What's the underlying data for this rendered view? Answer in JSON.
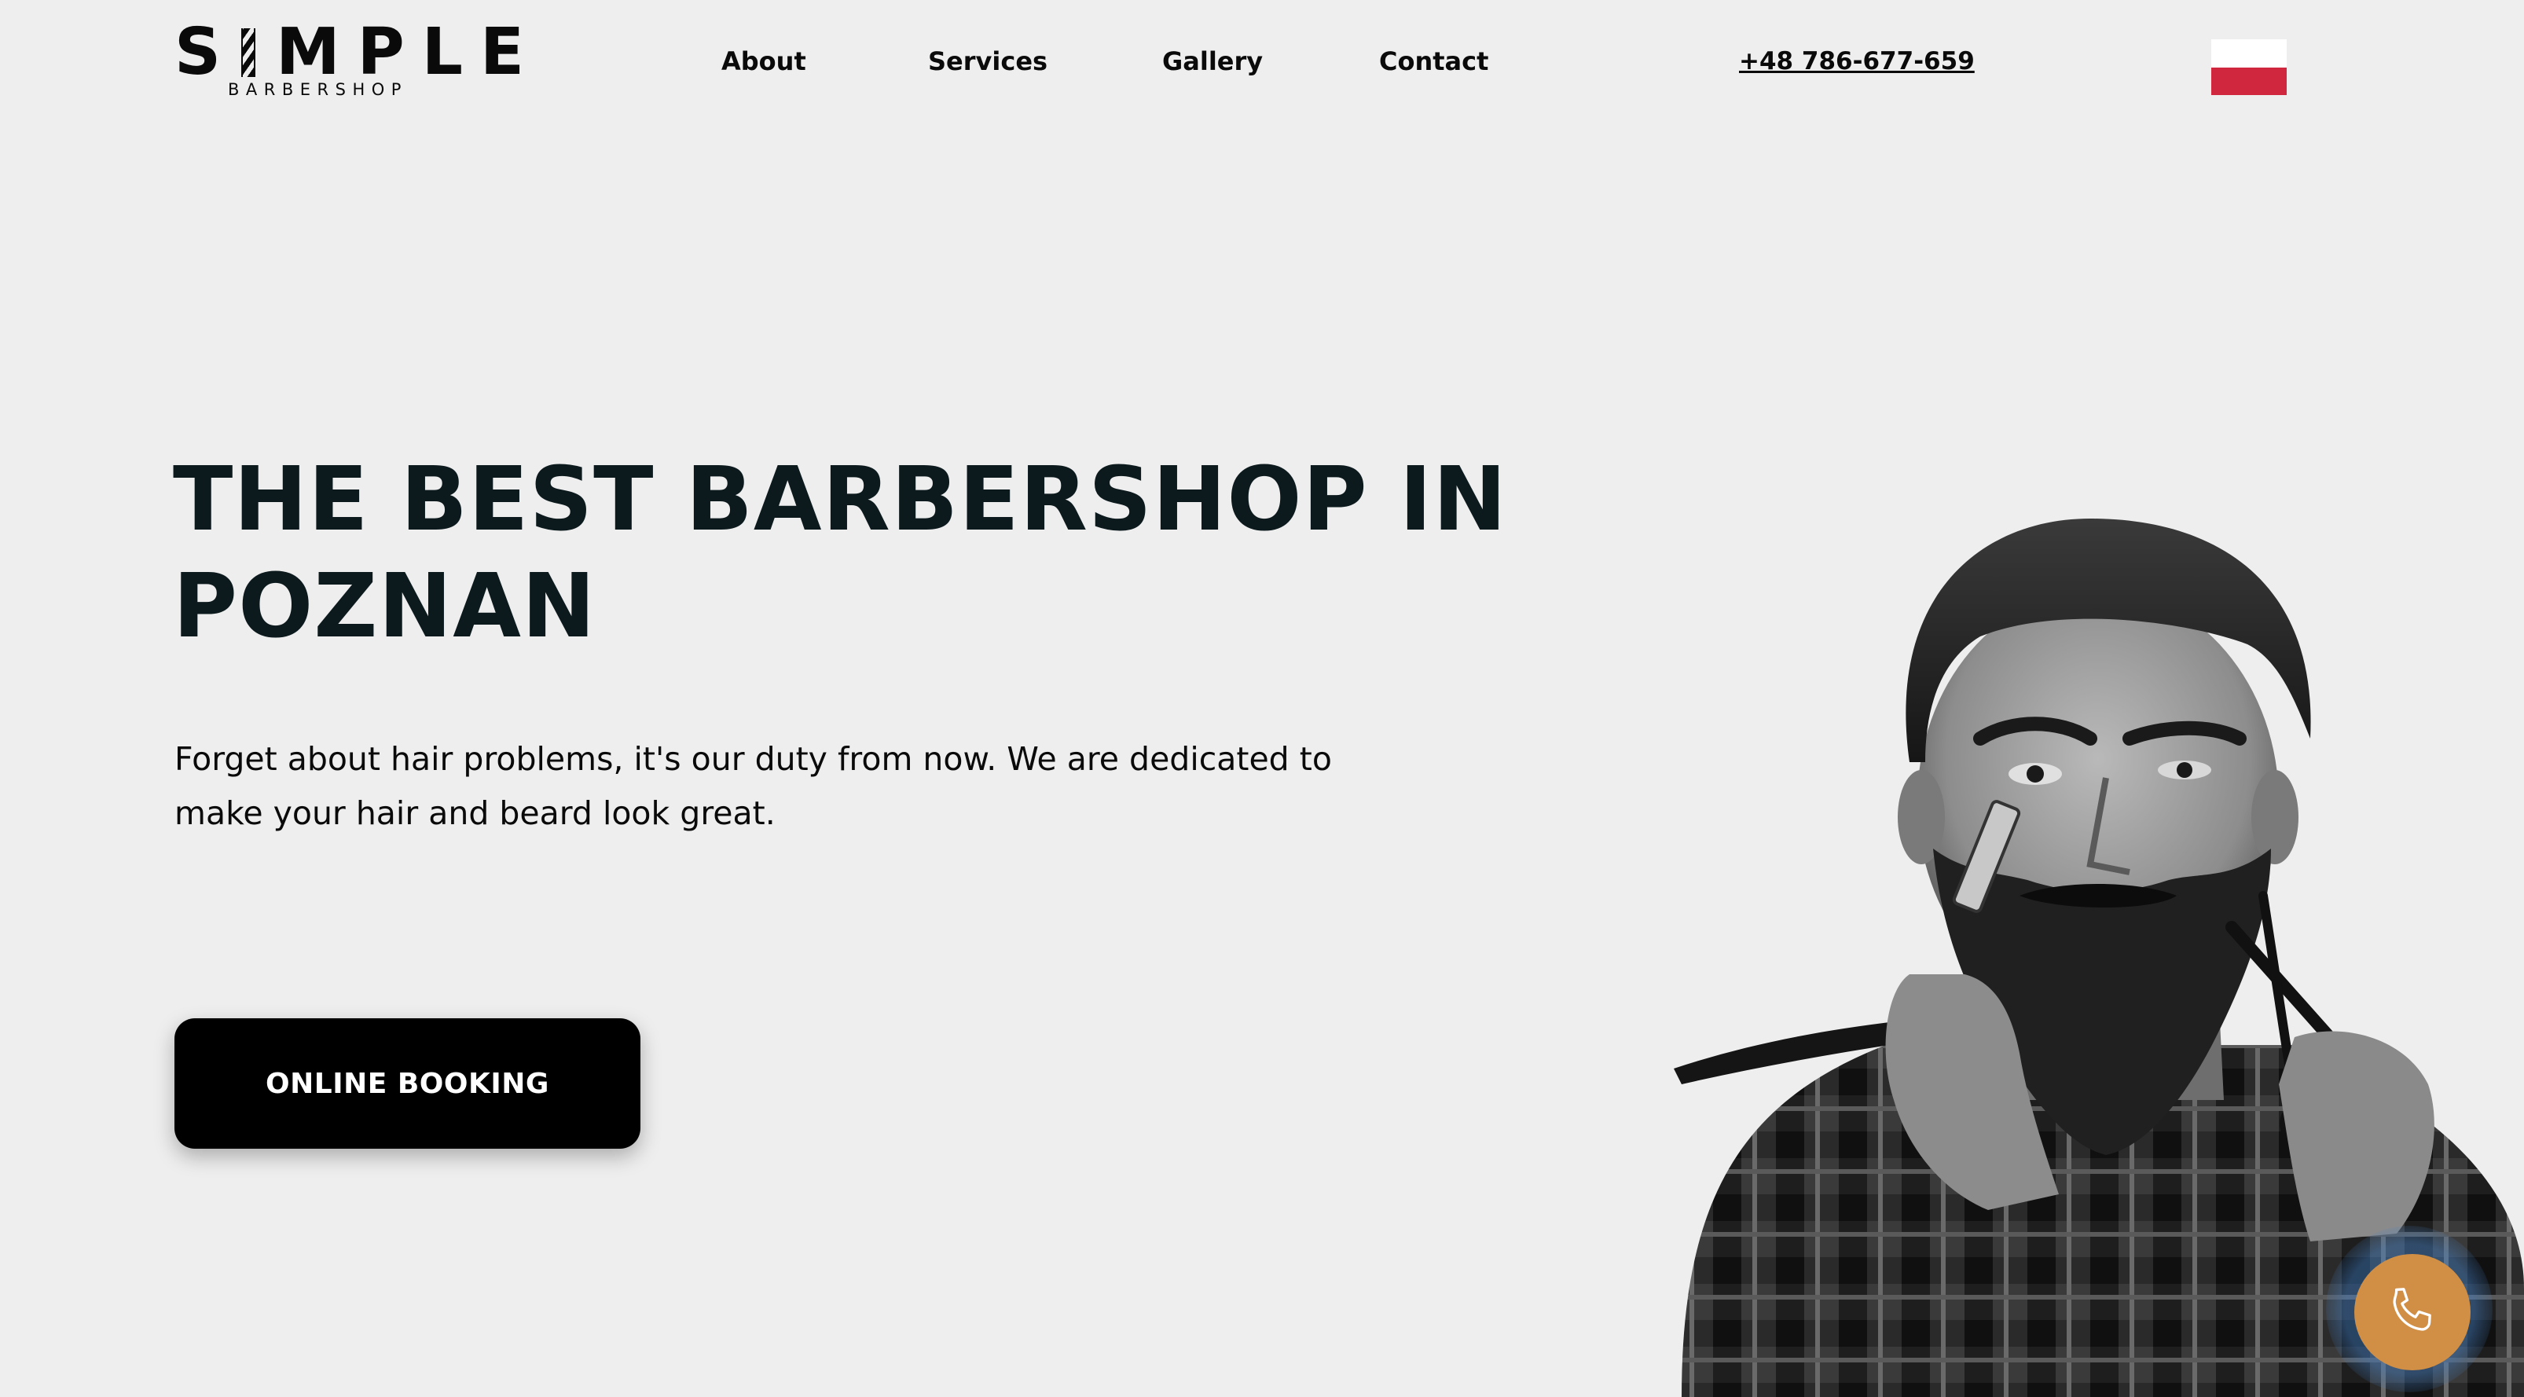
{
  "header": {
    "logo": {
      "word_start": "S",
      "word_end": "MPLE",
      "subtitle": "BARBERSHOP"
    },
    "nav": [
      {
        "label": "About"
      },
      {
        "label": "Services"
      },
      {
        "label": "Gallery"
      },
      {
        "label": "Contact"
      }
    ],
    "phone": "+48 786-677-659",
    "language_flag": {
      "colors": [
        "#ffffff",
        "#d0273f"
      ]
    }
  },
  "hero": {
    "title_line1": "THE BEST BARBERSHOP IN",
    "title_line2": "POZNAN",
    "text_line1": "Forget about hair problems, it's our duty from now. We are dedicated to",
    "text_line2": "make your hair and beard look great.",
    "cta": "ONLINE BOOKING"
  },
  "floating_call": {
    "icon": "phone-icon",
    "color": "#d08f45"
  }
}
